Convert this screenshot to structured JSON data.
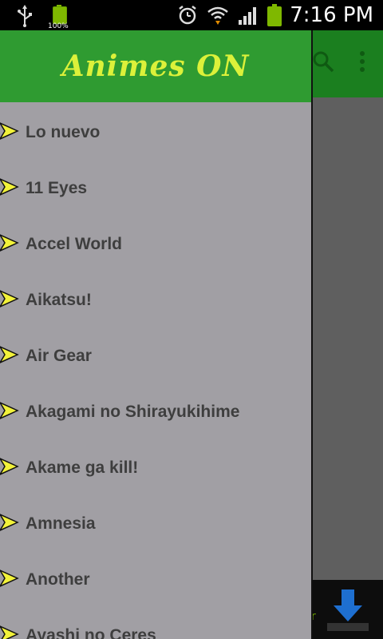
{
  "status_bar": {
    "battery_label": "100%",
    "time": "7:16 PM",
    "icons": [
      "usb-icon",
      "battery-icon",
      "alarm-icon",
      "wifi-icon",
      "signal-icon",
      "battery-icon"
    ]
  },
  "drawer": {
    "title": "Animes ON",
    "items": [
      {
        "label": "Lo nuevo"
      },
      {
        "label": "11 Eyes"
      },
      {
        "label": "Accel World"
      },
      {
        "label": "Aikatsu!"
      },
      {
        "label": "Air Gear"
      },
      {
        "label": "Akagami no Shirayukihime"
      },
      {
        "label": "Akame ga kill!"
      },
      {
        "label": "Amnesia"
      },
      {
        "label": "Another"
      },
      {
        "label": "Ayashi no Ceres"
      }
    ]
  },
  "background": {
    "ad_text": "r"
  },
  "colors": {
    "drawer_header": "#2f9b31",
    "title_color": "#dcf13a",
    "drawer_bg": "#a19fa4",
    "item_text": "#3e3e3e",
    "arrow_fill": "#f2f23a"
  }
}
